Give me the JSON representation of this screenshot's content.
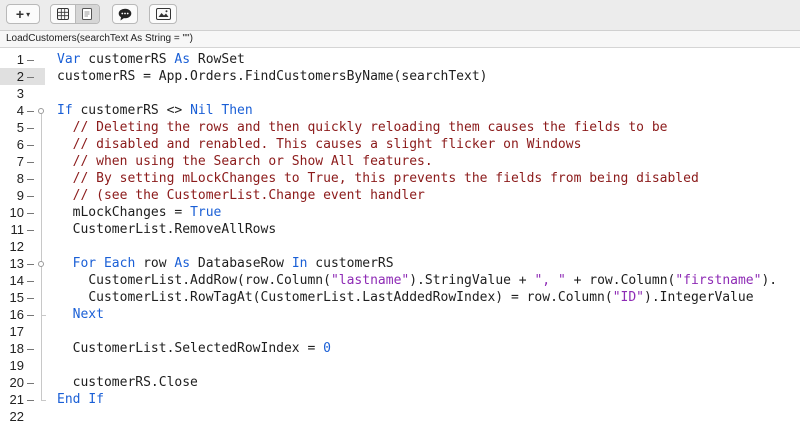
{
  "toolbar": {
    "plus_label": "+",
    "caret": "▾",
    "buttons": [
      {
        "name": "add-button",
        "icon": "plus-icon"
      },
      {
        "name": "view-mode-group",
        "icons": [
          "grid-icon",
          "document-icon"
        ]
      },
      {
        "name": "comment-button",
        "icon": "speech-bubble-icon"
      },
      {
        "name": "image-button",
        "icon": "picture-icon"
      }
    ]
  },
  "signature": "LoadCustomers(searchText As String = \"\")",
  "editor": {
    "current_line": 2,
    "line_numbers": [
      "1",
      "2",
      "3",
      "4",
      "5",
      "6",
      "7",
      "8",
      "9",
      "10",
      "11",
      "12",
      "13",
      "14",
      "15",
      "16",
      "17",
      "18",
      "19",
      "20",
      "21",
      "22"
    ],
    "lines": [
      {
        "indent": "",
        "segments": [
          {
            "t": "Var",
            "c": "kw"
          },
          {
            "t": " customerRS ",
            "c": ""
          },
          {
            "t": "As",
            "c": "kw"
          },
          {
            "t": " RowSet",
            "c": ""
          }
        ]
      },
      {
        "indent": "",
        "segments": [
          {
            "t": "customerRS = App.Orders.FindCustomersByName(searchText)",
            "c": ""
          }
        ]
      },
      {
        "indent": "",
        "segments": []
      },
      {
        "indent": "",
        "segments": [
          {
            "t": "If",
            "c": "kw"
          },
          {
            "t": " customerRS <> ",
            "c": ""
          },
          {
            "t": "Nil",
            "c": "kw"
          },
          {
            "t": " ",
            "c": ""
          },
          {
            "t": "Then",
            "c": "kw"
          }
        ]
      },
      {
        "indent": "  ",
        "segments": [
          {
            "t": "// Deleting the rows and then quickly reloading them causes the fields to be",
            "c": "cm"
          }
        ]
      },
      {
        "indent": "  ",
        "segments": [
          {
            "t": "// disabled and renabled. This causes a slight flicker on Windows",
            "c": "cm"
          }
        ]
      },
      {
        "indent": "  ",
        "segments": [
          {
            "t": "// when using the Search or Show All features.",
            "c": "cm"
          }
        ]
      },
      {
        "indent": "  ",
        "segments": [
          {
            "t": "// By setting mLockChanges to True, this prevents the fields from being disabled",
            "c": "cm"
          }
        ]
      },
      {
        "indent": "  ",
        "segments": [
          {
            "t": "// (see the CustomerList.Change event handler",
            "c": "cm"
          }
        ]
      },
      {
        "indent": "  ",
        "segments": [
          {
            "t": "mLockChanges = ",
            "c": ""
          },
          {
            "t": "True",
            "c": "kw"
          }
        ]
      },
      {
        "indent": "  ",
        "segments": [
          {
            "t": "CustomerList.RemoveAllRows",
            "c": ""
          }
        ]
      },
      {
        "indent": "",
        "segments": []
      },
      {
        "indent": "  ",
        "segments": [
          {
            "t": "For",
            "c": "kw"
          },
          {
            "t": " ",
            "c": ""
          },
          {
            "t": "Each",
            "c": "kw"
          },
          {
            "t": " row ",
            "c": ""
          },
          {
            "t": "As",
            "c": "kw"
          },
          {
            "t": " DatabaseRow ",
            "c": ""
          },
          {
            "t": "In",
            "c": "kw"
          },
          {
            "t": " customerRS",
            "c": ""
          }
        ]
      },
      {
        "indent": "    ",
        "segments": [
          {
            "t": "CustomerList.AddRow(row.Column(",
            "c": ""
          },
          {
            "t": "\"lastname\"",
            "c": "st"
          },
          {
            "t": ").StringValue + ",
            "c": ""
          },
          {
            "t": "\", \"",
            "c": "st"
          },
          {
            "t": " + row.Column(",
            "c": ""
          },
          {
            "t": "\"firstname\"",
            "c": "st"
          },
          {
            "t": ").",
            "c": ""
          }
        ]
      },
      {
        "indent": "    ",
        "segments": [
          {
            "t": "CustomerList.RowTagAt(CustomerList.LastAddedRowIndex) = row.Column(",
            "c": ""
          },
          {
            "t": "\"ID\"",
            "c": "st"
          },
          {
            "t": ").IntegerValue",
            "c": ""
          }
        ]
      },
      {
        "indent": "  ",
        "segments": [
          {
            "t": "Next",
            "c": "kw"
          }
        ]
      },
      {
        "indent": "",
        "segments": []
      },
      {
        "indent": "  ",
        "segments": [
          {
            "t": "CustomerList.SelectedRowIndex = ",
            "c": ""
          },
          {
            "t": "0",
            "c": "nm"
          }
        ]
      },
      {
        "indent": "",
        "segments": []
      },
      {
        "indent": "  ",
        "segments": [
          {
            "t": "customerRS.Close",
            "c": ""
          }
        ]
      },
      {
        "indent": "",
        "segments": [
          {
            "t": "End",
            "c": "kw"
          },
          {
            "t": " ",
            "c": ""
          },
          {
            "t": "If",
            "c": "kw"
          }
        ]
      },
      {
        "indent": "",
        "segments": []
      }
    ]
  },
  "colors": {
    "keyword": "#1a5fd6",
    "comment": "#8b1a1a",
    "string": "#8e2bb5",
    "current_line": "#e0e0e0"
  }
}
